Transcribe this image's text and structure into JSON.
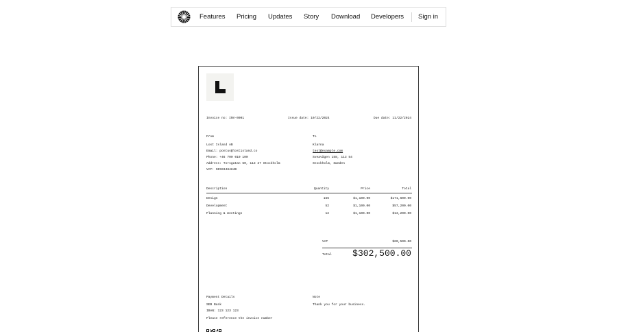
{
  "nav": {
    "items": [
      {
        "label": "Features"
      },
      {
        "label": "Pricing"
      },
      {
        "label": "Updates"
      },
      {
        "label": "Story"
      },
      {
        "label": "Download"
      },
      {
        "label": "Developers"
      }
    ],
    "sign_in": "Sign in",
    "logo_icon": "flower-logo-icon"
  },
  "invoice": {
    "meta": {
      "invoice_no": "Invoice no: INV-0001",
      "issue_date": "Issue date: 10/22/2024",
      "due_date": "Due date: 11/22/2024"
    },
    "from": {
      "heading": "From",
      "lines": [
        "Lost Island AB",
        "Email: pontus@lostisland.co",
        "Phone: +46 700 010 100",
        "Address: Torsgatan 50, 113 37 Stockholm",
        "VAT: SE59348484B"
      ]
    },
    "to": {
      "heading": "To",
      "name": "Klarna",
      "email": "test@example.com",
      "lines": [
        "Sveavägen 158, 113 54",
        "Stockholm, Sweden"
      ]
    },
    "table": {
      "headers": {
        "description": "Description",
        "quantity": "Quantity",
        "price": "Price",
        "total": "Total"
      },
      "rows": [
        {
          "description": "Design",
          "quantity": "156",
          "price": "$1,100.00",
          "total": "$171,600.00"
        },
        {
          "description": "Development",
          "quantity": "52",
          "price": "$1,100.00",
          "total": "$57,200.00"
        },
        {
          "description": "Planning & meetings",
          "quantity": "12",
          "price": "$1,100.00",
          "total": "$13,200.00"
        }
      ]
    },
    "summary": {
      "vat_label": "VAT",
      "vat_value": "$60,500.00",
      "total_label": "Total",
      "total_value": "$302,500.00"
    },
    "payment": {
      "heading": "Payment Details",
      "lines": [
        "SEB Bank",
        "IBAN: 123 123 123"
      ],
      "reference": "Please reference the invoice number"
    },
    "note": {
      "heading": "Note",
      "text": "Thank you for your business."
    }
  }
}
